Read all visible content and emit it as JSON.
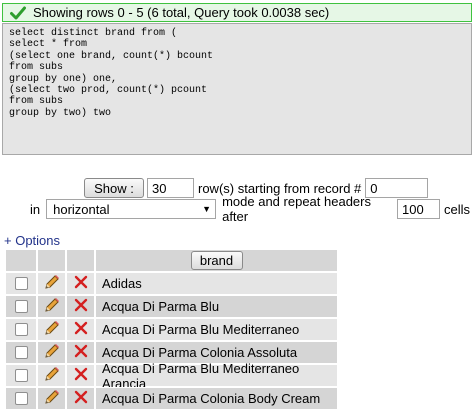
{
  "status": {
    "message": "Showing rows 0 - 5 (6 total, Query took 0.0038 sec)",
    "icon": "check-icon"
  },
  "sql": {
    "lines": [
      "select distinct brand from (",
      "select * from",
      "(select one brand, count(*) bcount",
      "from subs",
      "group by one) one,",
      "(select two prod, count(*) pcount",
      "from subs",
      "group by two) two"
    ]
  },
  "controls": {
    "show_label": "Show :",
    "rows_value": "30",
    "rows_text": "row(s) starting from record #",
    "start_value": "0",
    "in_text": "in",
    "mode_value": "horizontal",
    "mode_text": "mode and repeat headers after",
    "repeat_value": "100",
    "cells_text": "cells"
  },
  "options_link": "+ Options",
  "table": {
    "column_header": "brand",
    "rows": [
      "Adidas",
      "Acqua Di Parma Blu",
      "Acqua Di Parma Blu Mediterraneo",
      "Acqua Di Parma Colonia Assoluta",
      "Acqua Di Parma Blu Mediterraneo Arancia",
      "Acqua Di Parma Colonia Body Cream"
    ]
  },
  "colors": {
    "success_border": "#3fc23f",
    "success_bg": "#e6f7e6",
    "sql_bg": "#e5e5e5",
    "row_odd": "#e5e5e5",
    "row_even": "#d5d5d5",
    "delete_red": "#d42020",
    "link_blue": "#22338a"
  }
}
